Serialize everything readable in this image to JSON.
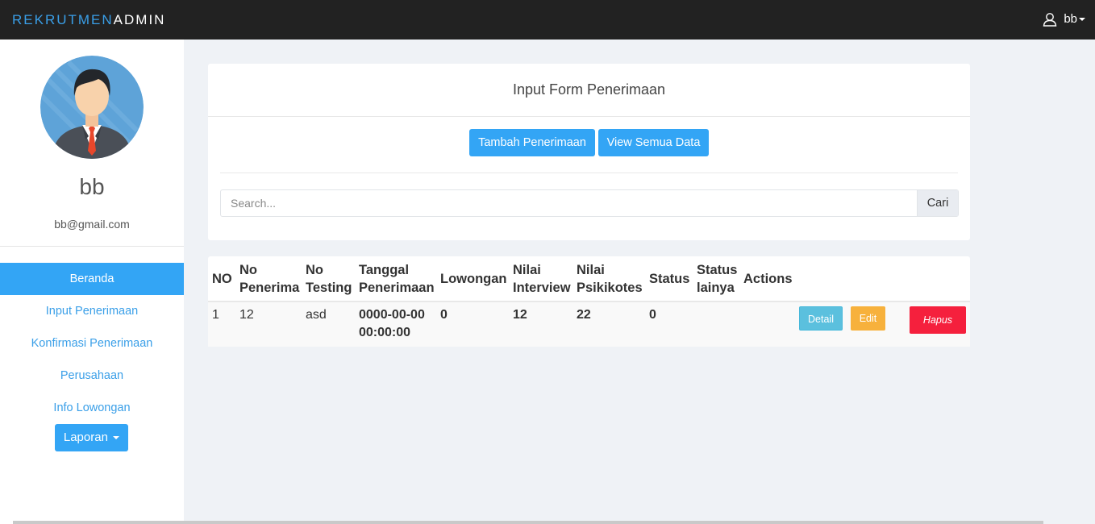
{
  "navbar": {
    "brand_part1": "REKRUTMEN",
    "brand_part2": "ADMIN",
    "user": "bb"
  },
  "sidebar": {
    "name": "bb",
    "email": "bb@gmail.com",
    "items": [
      {
        "label": "Beranda",
        "active": true
      },
      {
        "label": "Input Penerimaan"
      },
      {
        "label": "Konfirmasi Penerimaan"
      },
      {
        "label": "Perusahaan"
      },
      {
        "label": "Info Lowongan"
      }
    ],
    "laporan_label": "Laporan"
  },
  "form": {
    "title": "Input Form Penerimaan",
    "tambah_label": "Tambah Penerimaan",
    "view_label": "View Semua Data",
    "search_placeholder": "Search...",
    "search_button": "Cari"
  },
  "table": {
    "headers": [
      "NO",
      "No Penerima",
      "No Testing",
      "Tanggal Penerimaan",
      "Lowongan",
      "Nilai Interview",
      "Nilai Psikikotes",
      "Status",
      "Status lainya",
      "Actions"
    ],
    "header_lines": [
      [
        "NO"
      ],
      [
        "No",
        "Penerima"
      ],
      [
        "No",
        "Testing"
      ],
      [
        "Tanggal",
        "Penerimaan"
      ],
      [
        "Lowongan"
      ],
      [
        "Nilai",
        "Interview"
      ],
      [
        "Nilai",
        "Psikikotes"
      ],
      [
        "Status"
      ],
      [
        "Status",
        "lainya"
      ],
      [
        "Actions"
      ]
    ],
    "rows": [
      {
        "no": "1",
        "no_penerima": "12",
        "no_testing": "asd",
        "tanggal_line1": "0000-00-00",
        "tanggal_line2": "00:00:00",
        "lowongan": "0",
        "nilai_interview": "12",
        "nilai_psikikotes": "22",
        "status": "0",
        "status_lainya": "",
        "detail_label": "Detail",
        "edit_label": "Edit",
        "hapus_label": "Hapus"
      }
    ]
  },
  "colors": {
    "accent": "#33a5f5",
    "navbar": "#222222",
    "danger": "#f5203d",
    "warning": "#f7b13c",
    "info": "#5bc0de"
  }
}
